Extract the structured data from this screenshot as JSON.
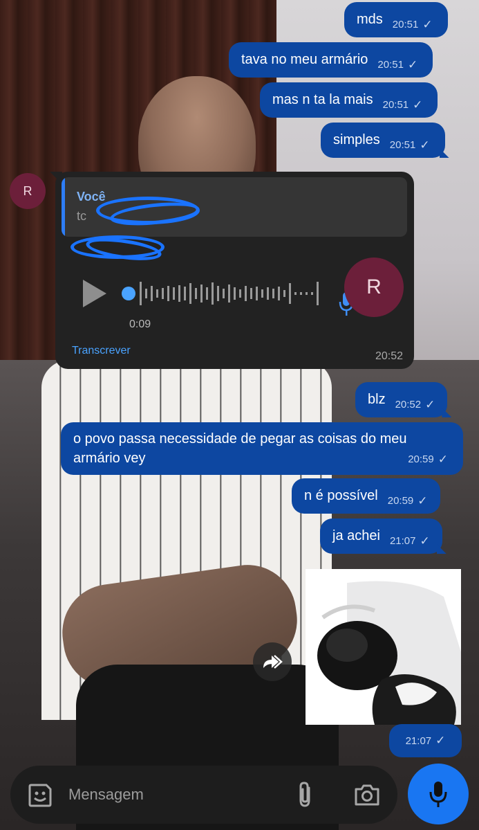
{
  "messages_out": [
    {
      "text": "mds",
      "time": "20:51"
    },
    {
      "text": "tava no meu armário",
      "time": "20:51"
    },
    {
      "text": "mas n ta la mais",
      "time": "20:51"
    },
    {
      "text": "simples",
      "time": "20:51"
    },
    {
      "text": "blz",
      "time": "20:52"
    },
    {
      "text": "n é possível",
      "time": "20:59"
    },
    {
      "text": "ja achei",
      "time": "21:07"
    }
  ],
  "multi_message": {
    "text": "o povo passa necessidade de pegar as coisas do meu armário vey",
    "time": "20:59"
  },
  "voice_message": {
    "avatar_initial": "R",
    "reply_author": "Você",
    "reply_snippet": "tc",
    "duration": "0:09",
    "transcribe_label": "Transcrever",
    "time": "20:52"
  },
  "sticker": {
    "time": "21:07"
  },
  "check_glyph": "✓",
  "composer": {
    "placeholder": "Mensagem"
  },
  "colors": {
    "outgoing": "#0d47a1",
    "incoming": "#222222",
    "accent": "#1976f2",
    "avatar": "#6c1f3a"
  },
  "icons": [
    "emoji-sticker-icon",
    "paperclip-icon",
    "camera-icon",
    "microphone-icon",
    "forward-icon",
    "play-icon"
  ]
}
